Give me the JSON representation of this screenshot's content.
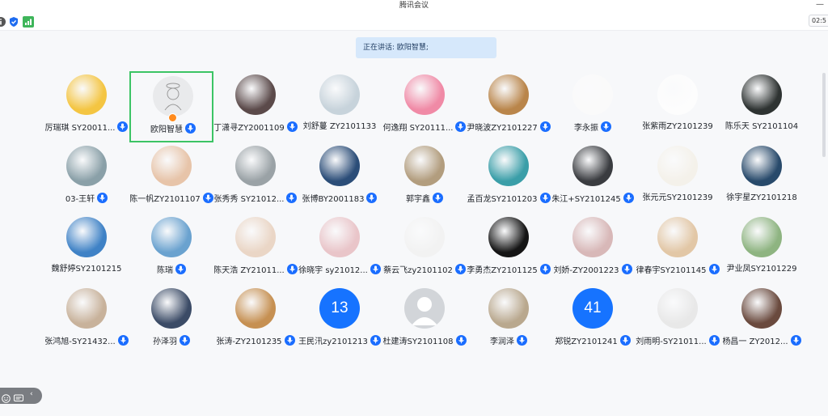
{
  "window": {
    "title": "腾讯会议"
  },
  "toolbar": {
    "timer": "02:5"
  },
  "speaking": {
    "text": "正在讲话: 欧阳智慧;"
  },
  "participants": [
    {
      "name": "厉瑞琪 SY20011...",
      "mic": true,
      "avatar": "cartoon-girl-red",
      "color": "#f4c542"
    },
    {
      "name": "欧阳智慧",
      "mic": true,
      "avatar": "sketch-figure",
      "color": "#e9eaec",
      "active": true,
      "host": true
    },
    {
      "name": "丁潇寻ZY2001109",
      "mic": true,
      "avatar": "photo-dark-hair",
      "color": "#5b4a4a"
    },
    {
      "name": "刘舒蔓 ZY2101133",
      "mic": false,
      "avatar": "anime-boy",
      "color": "#c7d3db"
    },
    {
      "name": "何逸翔 SY20111...",
      "mic": true,
      "avatar": "pink-flower-ring",
      "color": "#f08aa6"
    },
    {
      "name": "尹晓波ZY2101227",
      "mic": true,
      "avatar": "dog-photo",
      "color": "#b9854a"
    },
    {
      "name": "李永振",
      "mic": true,
      "avatar": "circular-logo",
      "color": "#fafafa"
    },
    {
      "name": "张紫雨ZY2101239",
      "mic": false,
      "avatar": "cartoon-face",
      "color": "#fdfdfd"
    },
    {
      "name": "陈乐天 SY2101104",
      "mic": false,
      "avatar": "photo-couple",
      "color": "#2e3332"
    },
    {
      "name": "03-王轩",
      "mic": true,
      "avatar": "dragon-art",
      "color": "#8aa0a8"
    },
    {
      "name": "陈一帆ZY2101107",
      "mic": true,
      "avatar": "baby-photo",
      "color": "#e7c4a9"
    },
    {
      "name": "张秀秀 SY21012...",
      "mic": true,
      "avatar": "photo-desk",
      "color": "#9aa2a6"
    },
    {
      "name": "张博BY2001183",
      "mic": true,
      "avatar": "snoopy",
      "color": "#2b4d78"
    },
    {
      "name": "郭宇鑫",
      "mic": true,
      "avatar": "window-pattern",
      "color": "#b29d7e"
    },
    {
      "name": "孟百龙SY2101203",
      "mic": true,
      "avatar": "anime-scene",
      "color": "#3a9ea8"
    },
    {
      "name": "朱江+SY2101245",
      "mic": true,
      "avatar": "anime-white-hair",
      "color": "#3a3c40"
    },
    {
      "name": "张元元SY2101239",
      "mic": false,
      "avatar": "calligraphy",
      "color": "#f4f1ea"
    },
    {
      "name": "徐宇星ZY2101218",
      "mic": false,
      "avatar": "dark-blue-flowers",
      "color": "#284a6b"
    },
    {
      "name": "魏舒婷SY2101215",
      "mic": false,
      "avatar": "anime-sky",
      "color": "#3f82c6"
    },
    {
      "name": "陈瑞",
      "mic": true,
      "avatar": "blue-water",
      "color": "#6aa2cf"
    },
    {
      "name": "陈天浩 ZY21011...",
      "mic": true,
      "avatar": "sketch-boy",
      "color": "#ead6c6"
    },
    {
      "name": "徐晓宇 sy21012...",
      "mic": true,
      "avatar": "anime-girl-pink",
      "color": "#e9c5c9"
    },
    {
      "name": "蔡云飞zy2101102",
      "mic": true,
      "avatar": "dragon-sketch",
      "color": "#f2f2f2"
    },
    {
      "name": "李勇杰ZY2101125",
      "mic": true,
      "avatar": "girl-red-ribbon",
      "color": "#151515"
    },
    {
      "name": "刘娇-ZY2001223",
      "mic": true,
      "avatar": "painting-girl",
      "color": "#d8b8b8"
    },
    {
      "name": "律春宇SY2101145",
      "mic": true,
      "avatar": "shiba-dog",
      "color": "#e2c7a6"
    },
    {
      "name": "尹业凤SY2101229",
      "mic": false,
      "avatar": "green-nature",
      "color": "#8eb481"
    },
    {
      "name": "张鸿旭-SY21432...",
      "mic": true,
      "avatar": "game-art",
      "color": "#c8b29b"
    },
    {
      "name": "孙泽羽",
      "mic": true,
      "avatar": "photo-street",
      "color": "#3b4b66"
    },
    {
      "name": "张涛-ZY2101235",
      "mic": true,
      "avatar": "golden-dog",
      "color": "#c69052"
    },
    {
      "name": "王民汛zy2101213",
      "mic": true,
      "avatar": "number",
      "number": "13",
      "color": "#1673ff"
    },
    {
      "name": "杜建涛SY2101108",
      "mic": true,
      "avatar": "default-user",
      "color": "#d2d5d9"
    },
    {
      "name": "李润泽",
      "mic": true,
      "avatar": "rabbit-photo",
      "color": "#b9a88e"
    },
    {
      "name": "郑锐ZY2101241",
      "mic": true,
      "avatar": "number",
      "number": "41",
      "color": "#1673ff"
    },
    {
      "name": "刘雨明-SY21011...",
      "mic": true,
      "avatar": "masked-figure",
      "color": "#e8e8e8"
    },
    {
      "name": "杨昌一 ZY2012...",
      "mic": true,
      "avatar": "photo-man",
      "color": "#6a4a3e"
    }
  ]
}
